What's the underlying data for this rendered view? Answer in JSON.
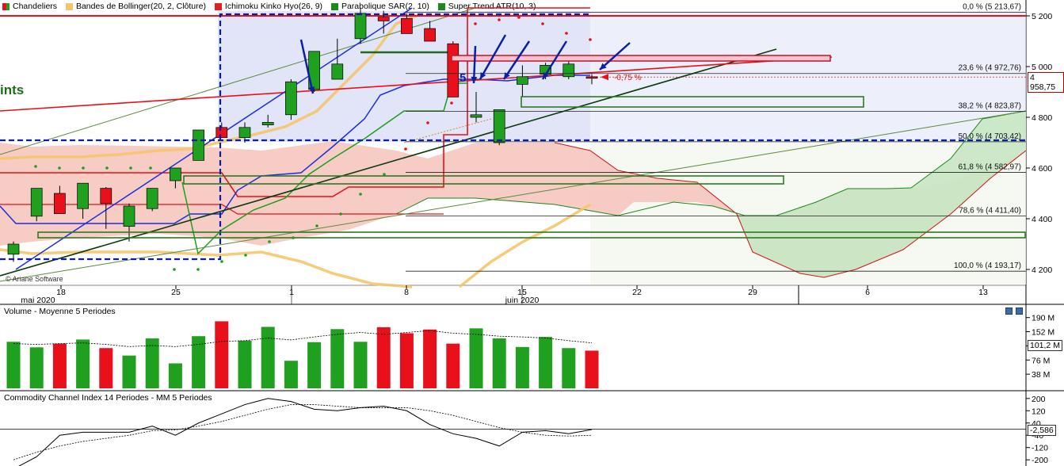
{
  "legend": {
    "items": [
      {
        "label": "Chandeliers",
        "color": "#2e9e2e"
      },
      {
        "label": "Bandes de Bollinger(20, 2, Clôture)",
        "color": "#f2c26b"
      },
      {
        "label": "Ichimoku Kinko Hyo(26, 9)",
        "color": "#e02020"
      },
      {
        "label": "Parabolique SAR(2, 10)",
        "color": "#1a8a1a"
      },
      {
        "label": "Super Trend ATR(10, 3)",
        "color": "#1a8a1a"
      }
    ]
  },
  "watermark": "© Ariane Software",
  "partial_label": "ints",
  "wave_label": "5",
  "price_panel": {
    "price_ticks": [
      "5 200",
      "5 000",
      "4 800",
      "4 600",
      "4 400",
      "4 200"
    ],
    "last_price": "4 958,75",
    "change": "-0,75 %",
    "fib_levels": [
      {
        "label": "0,0 % (5 213,67)",
        "value": 5213.67
      },
      {
        "label": "23,6 % (4 972,76)",
        "value": 4972.76
      },
      {
        "label": "38,2 % (4 823,87)",
        "value": 4823.87
      },
      {
        "label": "50,0 % (4 703,42)",
        "value": 4703.42
      },
      {
        "label": "61,8 % (4 582,97)",
        "value": 4582.97
      },
      {
        "label": "78,6 % (4 411,40)",
        "value": 4411.4
      },
      {
        "label": "100,0 % (4 193,17)",
        "value": 4193.17
      }
    ]
  },
  "date_axis": {
    "days": [
      "18",
      "25",
      "1",
      "8",
      "15",
      "22",
      "29",
      "6",
      "13"
    ],
    "months": [
      "mai 2020",
      "juin 2020"
    ]
  },
  "volume_panel": {
    "title": "Volume  - Moyenne 5 Periodes",
    "ticks": [
      "190 M",
      "152 M",
      "114 M",
      "76 M",
      "38 M"
    ],
    "last_value": "101,2 M"
  },
  "cci_panel": {
    "title": "Commodity Channel Index 14 Periodes - MM  5 Periodes",
    "ticks": [
      "200",
      "120",
      "40",
      "-40",
      "-120",
      "-200"
    ],
    "last_value": "-2,586"
  },
  "chart_data": {
    "type": "candlestick",
    "title": "",
    "x": [
      "2020-05-15",
      "2020-05-18",
      "2020-05-19",
      "2020-05-20",
      "2020-05-21",
      "2020-05-22",
      "2020-05-25",
      "2020-05-26",
      "2020-05-27",
      "2020-05-28",
      "2020-05-29",
      "2020-06-01",
      "2020-06-02",
      "2020-06-03",
      "2020-06-04",
      "2020-06-05",
      "2020-06-08",
      "2020-06-09",
      "2020-06-10",
      "2020-06-11",
      "2020-06-12",
      "2020-06-15",
      "2020-06-16",
      "2020-06-17",
      "2020-06-18",
      "2020-06-19"
    ],
    "open": [
      4260,
      4410,
      4500,
      4440,
      4520,
      4370,
      4440,
      4550,
      4630,
      4760,
      4720,
      4770,
      4810,
      4910,
      4950,
      5110,
      5195,
      5190,
      5150,
      5090,
      4800,
      4700,
      4930,
      4970,
      4960,
      4960
    ],
    "high": [
      4310,
      4440,
      4530,
      4535,
      4525,
      4460,
      4470,
      4570,
      4730,
      4780,
      4780,
      4810,
      4950,
      5040,
      5110,
      5230,
      5220,
      5210,
      5180,
      5100,
      4900,
      4830,
      5005,
      5015,
      5020,
      4970
    ],
    "low": [
      4230,
      4390,
      4420,
      4400,
      4360,
      4310,
      4430,
      4520,
      4650,
      4720,
      4700,
      4760,
      4790,
      4900,
      4950,
      5090,
      5130,
      5140,
      5140,
      4960,
      4780,
      4690,
      4880,
      4950,
      4950,
      4930
    ],
    "close": [
      4300,
      4520,
      4420,
      4540,
      4460,
      4450,
      4520,
      4600,
      4750,
      4720,
      4760,
      4780,
      4940,
      5060,
      5010,
      5210,
      5180,
      5130,
      5100,
      4880,
      4810,
      4830,
      4960,
      5005,
      5010,
      4958.75
    ],
    "volume_m": [
      125,
      110,
      120,
      131,
      108,
      88,
      134,
      67,
      140,
      180,
      128,
      165,
      74,
      124,
      159,
      125,
      164,
      148,
      158,
      120,
      161,
      134,
      111,
      138,
      108,
      101.2
    ],
    "volume_ma5_m": [
      120,
      118,
      120,
      122,
      118,
      112,
      115,
      112,
      118,
      126,
      128,
      135,
      130,
      138,
      145,
      150,
      145,
      150,
      155,
      148,
      145,
      140,
      138,
      135,
      128,
      122
    ],
    "cci": [
      -260,
      -180,
      -40,
      -20,
      -20,
      -20,
      20,
      -40,
      40,
      100,
      160,
      200,
      180,
      130,
      120,
      140,
      150,
      120,
      30,
      -30,
      -60,
      -110,
      -20,
      -10,
      -30,
      -2.586
    ],
    "cci_ma5": [
      -200,
      -150,
      -110,
      -80,
      -60,
      -40,
      -10,
      -5,
      20,
      50,
      90,
      130,
      160,
      160,
      150,
      140,
      140,
      140,
      120,
      90,
      50,
      10,
      -20,
      -40,
      -45,
      -40
    ],
    "price_ylim": [
      4180,
      5240
    ],
    "volume_ylim": [
      0,
      200
    ],
    "cci_ylim": [
      -230,
      230
    ],
    "grid": false,
    "legend_position": "top-left"
  },
  "colors": {
    "up": "#1fa01f",
    "down": "#e8101a",
    "accent_blue": "#0a1fa8",
    "kumo_green": "#c9e7c5",
    "kumo_red": "#f4c3bb",
    "bollinger": "#f5c56a"
  }
}
